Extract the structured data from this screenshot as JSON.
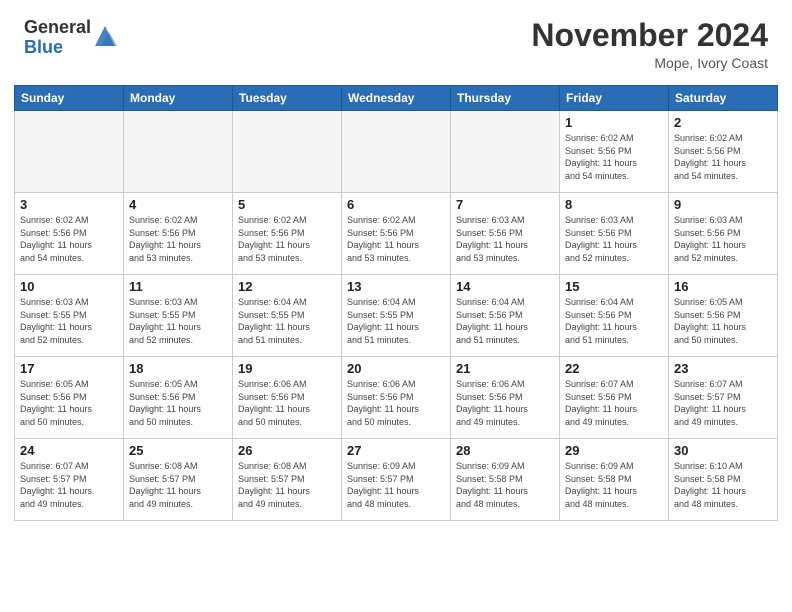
{
  "header": {
    "logo_general": "General",
    "logo_blue": "Blue",
    "month_title": "November 2024",
    "location": "Mope, Ivory Coast"
  },
  "days_of_week": [
    "Sunday",
    "Monday",
    "Tuesday",
    "Wednesday",
    "Thursday",
    "Friday",
    "Saturday"
  ],
  "weeks": [
    [
      {
        "day": "",
        "info": ""
      },
      {
        "day": "",
        "info": ""
      },
      {
        "day": "",
        "info": ""
      },
      {
        "day": "",
        "info": ""
      },
      {
        "day": "",
        "info": ""
      },
      {
        "day": "1",
        "info": "Sunrise: 6:02 AM\nSunset: 5:56 PM\nDaylight: 11 hours\nand 54 minutes."
      },
      {
        "day": "2",
        "info": "Sunrise: 6:02 AM\nSunset: 5:56 PM\nDaylight: 11 hours\nand 54 minutes."
      }
    ],
    [
      {
        "day": "3",
        "info": "Sunrise: 6:02 AM\nSunset: 5:56 PM\nDaylight: 11 hours\nand 54 minutes."
      },
      {
        "day": "4",
        "info": "Sunrise: 6:02 AM\nSunset: 5:56 PM\nDaylight: 11 hours\nand 53 minutes."
      },
      {
        "day": "5",
        "info": "Sunrise: 6:02 AM\nSunset: 5:56 PM\nDaylight: 11 hours\nand 53 minutes."
      },
      {
        "day": "6",
        "info": "Sunrise: 6:02 AM\nSunset: 5:56 PM\nDaylight: 11 hours\nand 53 minutes."
      },
      {
        "day": "7",
        "info": "Sunrise: 6:03 AM\nSunset: 5:56 PM\nDaylight: 11 hours\nand 53 minutes."
      },
      {
        "day": "8",
        "info": "Sunrise: 6:03 AM\nSunset: 5:56 PM\nDaylight: 11 hours\nand 52 minutes."
      },
      {
        "day": "9",
        "info": "Sunrise: 6:03 AM\nSunset: 5:56 PM\nDaylight: 11 hours\nand 52 minutes."
      }
    ],
    [
      {
        "day": "10",
        "info": "Sunrise: 6:03 AM\nSunset: 5:55 PM\nDaylight: 11 hours\nand 52 minutes."
      },
      {
        "day": "11",
        "info": "Sunrise: 6:03 AM\nSunset: 5:55 PM\nDaylight: 11 hours\nand 52 minutes."
      },
      {
        "day": "12",
        "info": "Sunrise: 6:04 AM\nSunset: 5:55 PM\nDaylight: 11 hours\nand 51 minutes."
      },
      {
        "day": "13",
        "info": "Sunrise: 6:04 AM\nSunset: 5:55 PM\nDaylight: 11 hours\nand 51 minutes."
      },
      {
        "day": "14",
        "info": "Sunrise: 6:04 AM\nSunset: 5:56 PM\nDaylight: 11 hours\nand 51 minutes."
      },
      {
        "day": "15",
        "info": "Sunrise: 6:04 AM\nSunset: 5:56 PM\nDaylight: 11 hours\nand 51 minutes."
      },
      {
        "day": "16",
        "info": "Sunrise: 6:05 AM\nSunset: 5:56 PM\nDaylight: 11 hours\nand 50 minutes."
      }
    ],
    [
      {
        "day": "17",
        "info": "Sunrise: 6:05 AM\nSunset: 5:56 PM\nDaylight: 11 hours\nand 50 minutes."
      },
      {
        "day": "18",
        "info": "Sunrise: 6:05 AM\nSunset: 5:56 PM\nDaylight: 11 hours\nand 50 minutes."
      },
      {
        "day": "19",
        "info": "Sunrise: 6:06 AM\nSunset: 5:56 PM\nDaylight: 11 hours\nand 50 minutes."
      },
      {
        "day": "20",
        "info": "Sunrise: 6:06 AM\nSunset: 5:56 PM\nDaylight: 11 hours\nand 50 minutes."
      },
      {
        "day": "21",
        "info": "Sunrise: 6:06 AM\nSunset: 5:56 PM\nDaylight: 11 hours\nand 49 minutes."
      },
      {
        "day": "22",
        "info": "Sunrise: 6:07 AM\nSunset: 5:56 PM\nDaylight: 11 hours\nand 49 minutes."
      },
      {
        "day": "23",
        "info": "Sunrise: 6:07 AM\nSunset: 5:57 PM\nDaylight: 11 hours\nand 49 minutes."
      }
    ],
    [
      {
        "day": "24",
        "info": "Sunrise: 6:07 AM\nSunset: 5:57 PM\nDaylight: 11 hours\nand 49 minutes."
      },
      {
        "day": "25",
        "info": "Sunrise: 6:08 AM\nSunset: 5:57 PM\nDaylight: 11 hours\nand 49 minutes."
      },
      {
        "day": "26",
        "info": "Sunrise: 6:08 AM\nSunset: 5:57 PM\nDaylight: 11 hours\nand 49 minutes."
      },
      {
        "day": "27",
        "info": "Sunrise: 6:09 AM\nSunset: 5:57 PM\nDaylight: 11 hours\nand 48 minutes."
      },
      {
        "day": "28",
        "info": "Sunrise: 6:09 AM\nSunset: 5:58 PM\nDaylight: 11 hours\nand 48 minutes."
      },
      {
        "day": "29",
        "info": "Sunrise: 6:09 AM\nSunset: 5:58 PM\nDaylight: 11 hours\nand 48 minutes."
      },
      {
        "day": "30",
        "info": "Sunrise: 6:10 AM\nSunset: 5:58 PM\nDaylight: 11 hours\nand 48 minutes."
      }
    ]
  ]
}
